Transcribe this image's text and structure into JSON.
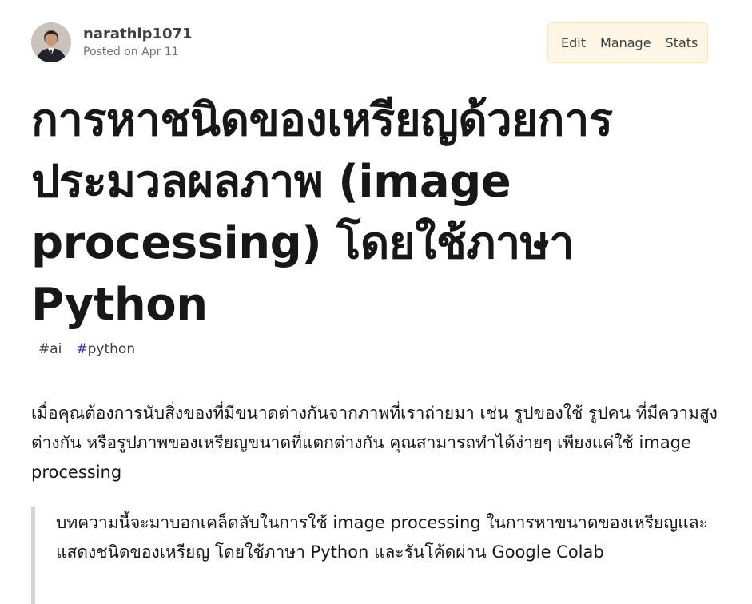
{
  "author": {
    "name": "narathip1071",
    "posted": "Posted on Apr 11"
  },
  "actions": {
    "edit": "Edit",
    "manage": "Manage",
    "stats": "Stats"
  },
  "article": {
    "title": "การหาชนิดของเหรียญด้วยการประมวลผลภาพ (image processing) โดยใช้ภาษา Python",
    "tags": [
      {
        "hash": "#",
        "label": "ai"
      },
      {
        "hash": "#",
        "label": "python"
      }
    ],
    "intro": "เมื่อคุณต้องการนับสิ่งของที่มีขนาดต่างกันจากภาพที่เราถ่ายมา เช่น รูปของใช้ รูปคน ที่มีความสูงต่างกัน หรือรูปภาพของเหรียญขนาดที่แตกต่างกัน คุณสามารถทำได้ง่ายๆ เพียงแค่ใช้ image processing",
    "quote": "บทความนี้จะมาบอกเคล็ดลับในการใช้ image processing ในการหาขนาดของเหรียญและแสดงชนิดของเหรียญ โดยใช้ภาษา Python และรันโค้ดผ่าน Google Colab"
  },
  "colors": {
    "action_bg": "#fff6e6",
    "python_tag_hash": "#2f3ab8"
  }
}
